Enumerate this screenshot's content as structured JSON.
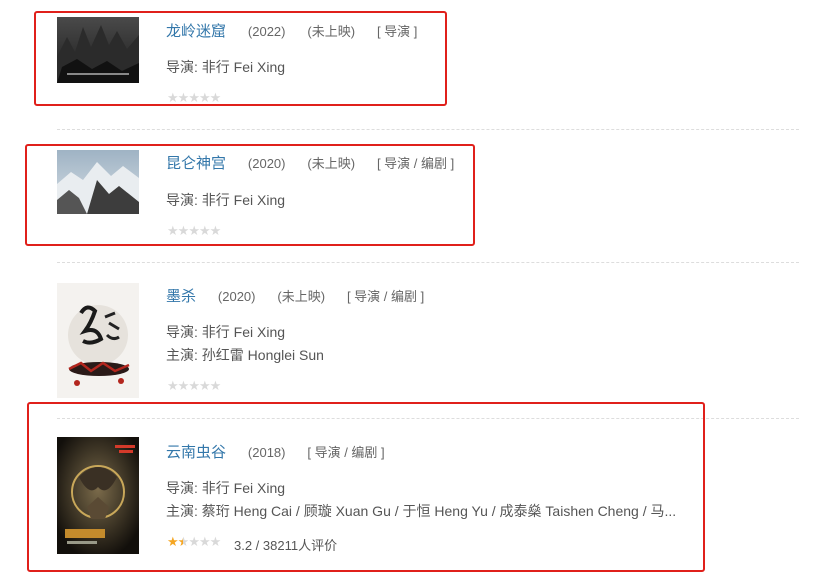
{
  "items": [
    {
      "title": "龙岭迷窟",
      "year": "(2022)",
      "status": "(未上映)",
      "roles": "[ 导演 ]",
      "director": "导演: 非行 Fei Xing",
      "cast": "",
      "rating": "",
      "stars": 0
    },
    {
      "title": "昆仑神宫",
      "year": "(2020)",
      "status": "(未上映)",
      "roles": "[ 导演 / 编剧 ]",
      "director": "导演: 非行 Fei Xing",
      "cast": "",
      "rating": "",
      "stars": 0
    },
    {
      "title": "墨杀",
      "year": "(2020)",
      "status": "(未上映)",
      "roles": "[ 导演 / 编剧 ]",
      "director": "导演: 非行 Fei Xing",
      "cast": "主演: 孙红雷 Honglei Sun",
      "rating": "",
      "stars": 0
    },
    {
      "title": "云南虫谷",
      "year": "(2018)",
      "status": "",
      "roles": "[ 导演 / 编剧 ]",
      "director": "导演: 非行 Fei Xing",
      "cast": "主演: 蔡珩 Heng Cai / 顾璇 Xuan Gu / 于恒 Heng Yu / 成泰燊 Taishen Cheng / 马...",
      "rating": "3.2 / 38211人评价",
      "stars": 1.5
    }
  ],
  "colors": {
    "link": "#3377aa",
    "highlight_box": "#e0201b",
    "star_on": "#f5a623",
    "star_off": "#d9d9d9"
  }
}
